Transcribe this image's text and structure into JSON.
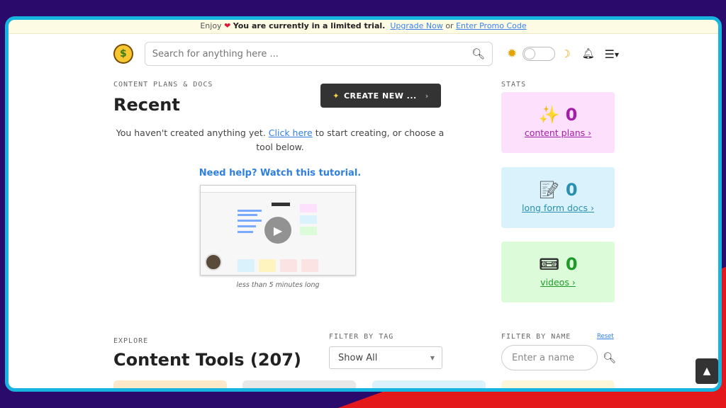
{
  "trial": {
    "prefix": "Enjoy",
    "message": "You are currently in a limited trial.",
    "upgrade_link": "Upgrade Now",
    "or": "or",
    "promo_link": "Enter Promo Code"
  },
  "header": {
    "search_placeholder": "Search for anything here ..."
  },
  "recent": {
    "section_label": "CONTENT PLANS & DOCS",
    "title": "Recent",
    "create_button": "CREATE NEW ...",
    "empty_before": "You haven't created anything yet.",
    "empty_link": "Click here",
    "empty_after": "to start creating, or choose a tool below.",
    "help_link": "Need help? Watch this tutorial.",
    "video_caption": "less than 5 minutes long"
  },
  "stats": {
    "label": "STATS",
    "items": [
      {
        "icon": "sparkles-icon",
        "count": "0",
        "label": "content plans"
      },
      {
        "icon": "memo-icon",
        "count": "0",
        "label": "long form docs"
      },
      {
        "icon": "video-camera-icon",
        "count": "0",
        "label": "videos"
      }
    ]
  },
  "explore": {
    "section_label": "EXPLORE",
    "title": "Content Tools (207)",
    "filter_tag_label": "FILTER BY TAG",
    "filter_tag_value": "Show All",
    "filter_name_label": "FILTER BY NAME",
    "reset_link": "Reset",
    "name_placeholder": "Enter a name"
  },
  "colors": {
    "frame_border": "#18b4e0",
    "link": "#2f7fe0",
    "plans_bg": "#fde0fb",
    "docs_bg": "#d9f2fb",
    "videos_bg": "#dcfbd9"
  }
}
